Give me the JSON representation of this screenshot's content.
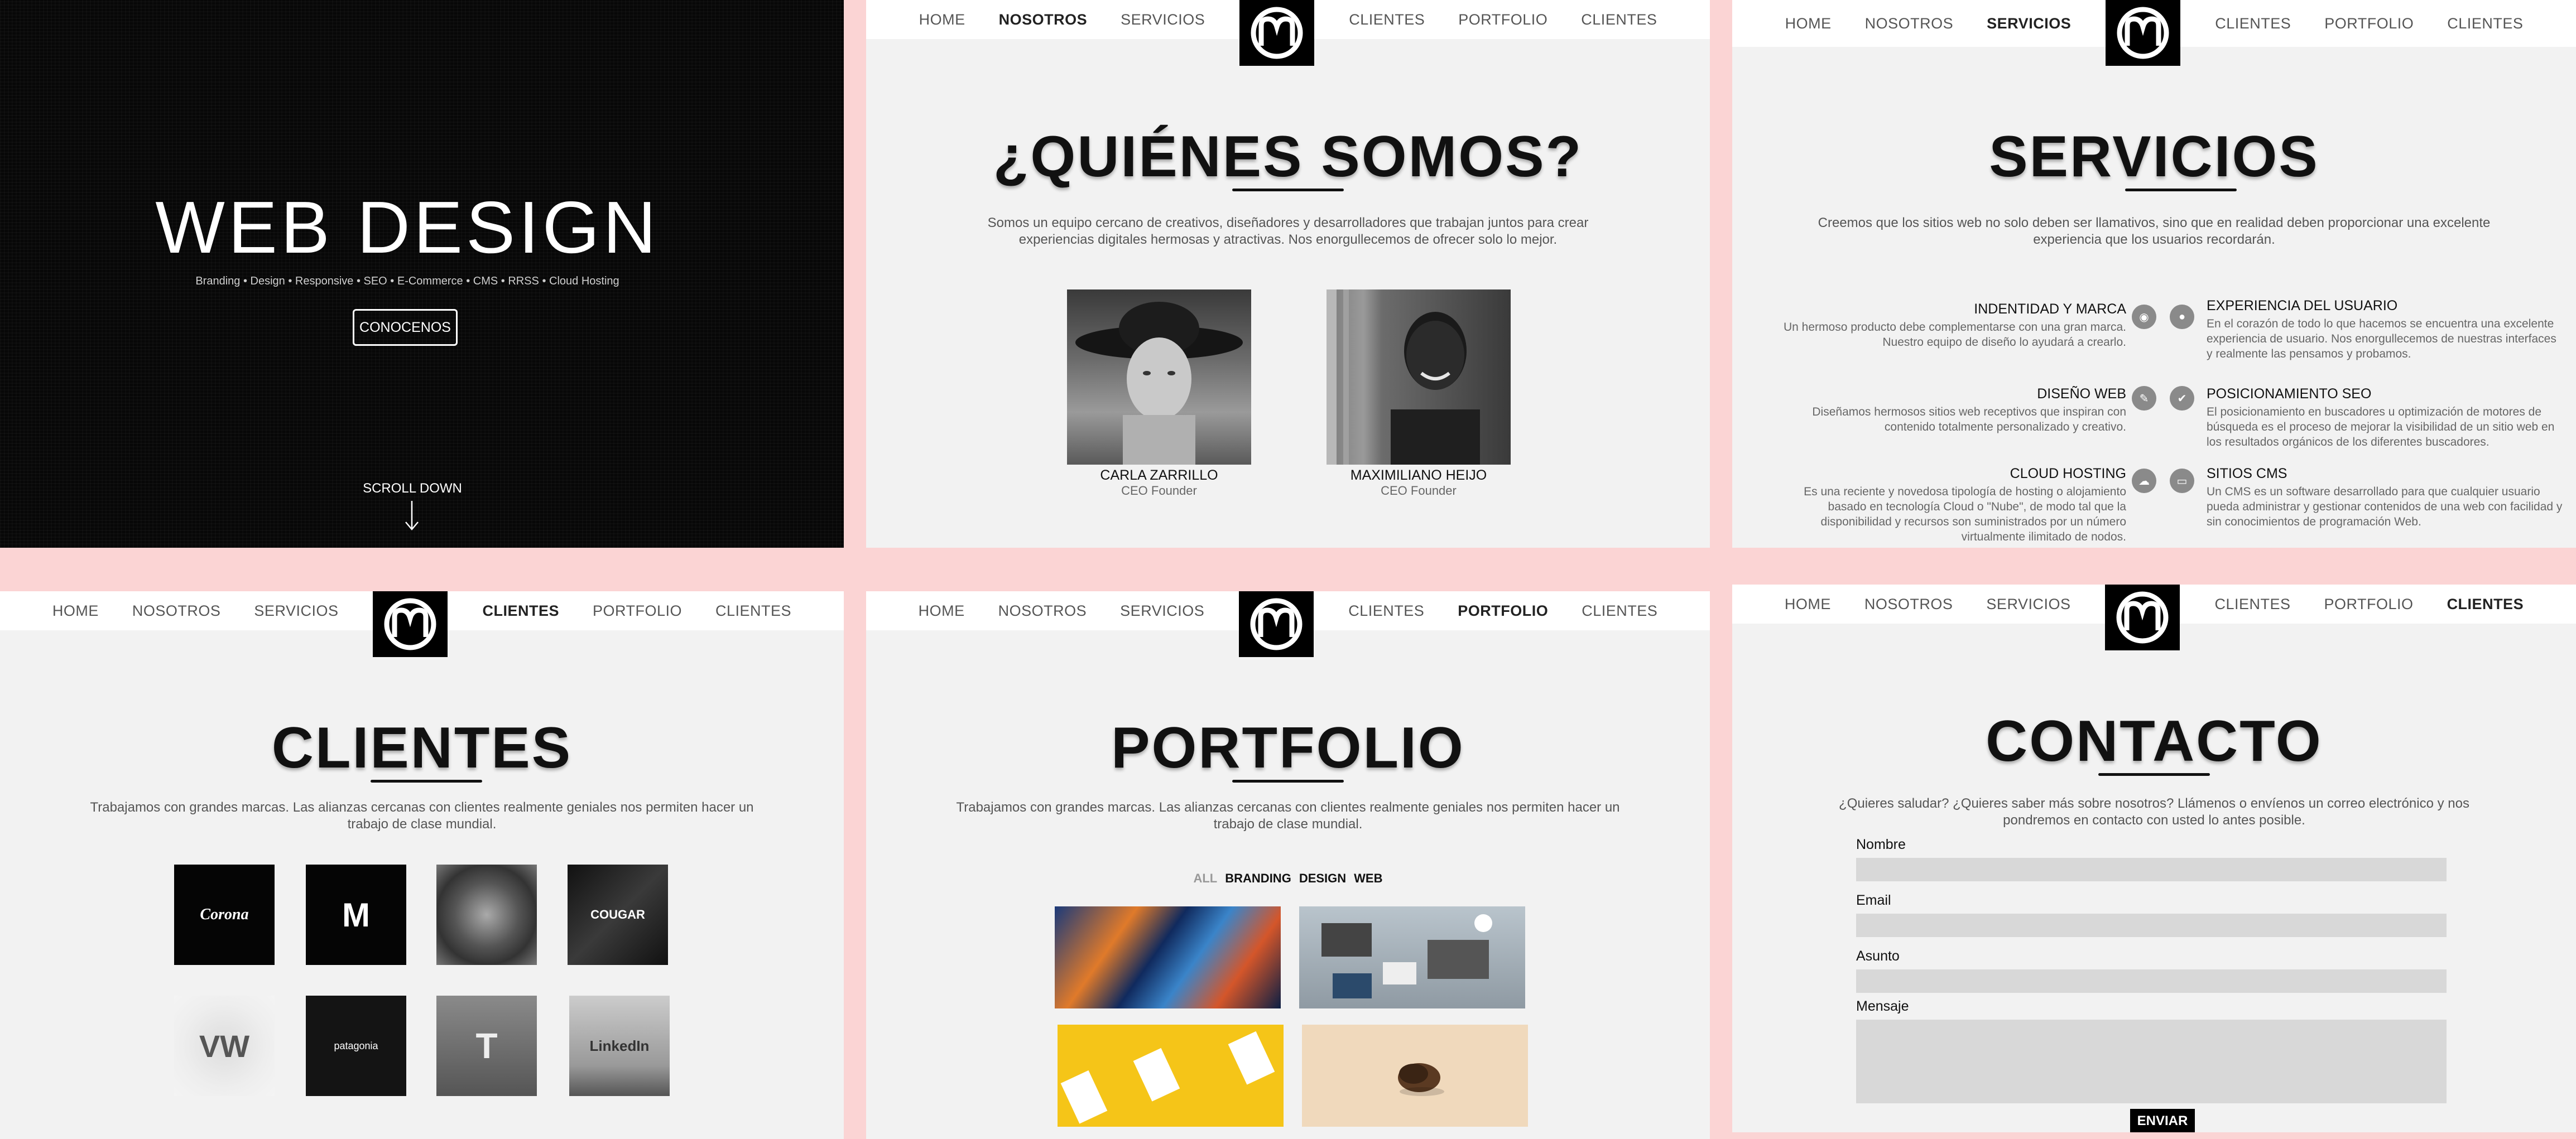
{
  "nav": {
    "left": [
      "HOME",
      "NOSOTROS",
      "SERVICIOS"
    ],
    "right": [
      "CLIENTES",
      "PORTFOLIO",
      "CLIENTES"
    ]
  },
  "hero": {
    "title": "WEB DESIGN",
    "subtitle": "Branding • Design • Responsive • SEO • E-Commerce • CMS • RRSS • Cloud Hosting",
    "button": "CONOCENOS",
    "scroll": "SCROLL DOWN"
  },
  "nosotros": {
    "title": "¿QUIÉNES SOMOS?",
    "text": "Somos un equipo cercano de creativos, diseñadores y desarrolladores que trabajan juntos para crear experiencias digitales hermosas y atractivas. Nos enorgullecemos de ofrecer solo lo mejor.",
    "team": [
      {
        "name": "CARLA ZARRILLO",
        "role": "CEO Founder"
      },
      {
        "name": "MAXIMILIANO HEIJO",
        "role": "CEO Founder"
      }
    ]
  },
  "servicios": {
    "title": "SERVICIOS",
    "text": "Creemos que los sitios web no solo deben ser llamativos, sino que en realidad deben proporcionar una excelente experiencia que los usuarios recordarán.",
    "items": [
      {
        "title": "INDENTIDAD Y MARCA",
        "text": "Un hermoso producto debe complementarse con una gran marca. Nuestro equipo de diseño lo ayudará a crearlo.",
        "icon": "eye-icon",
        "glyph": "◉"
      },
      {
        "title": "EXPERIENCIA DEL USUARIO",
        "text": "En el corazón de todo lo que hacemos se encuentra una excelente experiencia de usuario. Nos enorgullecemos de nuestras interfaces y realmente las pensamos y probamos.",
        "icon": "user-icon",
        "glyph": "●"
      },
      {
        "title": "DISEÑO WEB",
        "text": "Diseñamos hermosos sitios web receptivos que inspiran con contenido totalmente personalizado y creativo.",
        "icon": "wrench-icon",
        "glyph": "✎"
      },
      {
        "title": "POSICIONAMIENTO SEO",
        "text": "El posicionamiento en buscadores u optimización de motores de búsqueda es el proceso de mejorar la visibilidad de un sitio web en los resultados orgánicos de los diferentes buscadores.",
        "icon": "check-icon",
        "glyph": "✔"
      },
      {
        "title": "CLOUD HOSTING",
        "text": "Es una reciente y novedosa tipología de hosting o alojamiento basado en tecnología Cloud o \"Nube\", de modo tal que la disponibilidad y recursos son suministrados por un número virtualmente ilimitado de nodos.",
        "icon": "cloud-icon",
        "glyph": "☁"
      },
      {
        "title": "SITIOS CMS",
        "text": "Un CMS es un software desarrollado para que cualquier usuario pueda administrar y gestionar contenidos de una web con facilidad y sin conocimientos de programación Web.",
        "icon": "monitor-icon",
        "glyph": "▭"
      }
    ]
  },
  "clientes": {
    "title": "CLIENTES",
    "text": "Trabajamos con grandes marcas. Las alianzas cercanas con clientes realmente geniales nos permiten hacer un trabajo de clase mundial.",
    "logos": [
      {
        "label": "Corona"
      },
      {
        "label": "M"
      },
      {
        "label": ""
      },
      {
        "label": "COUGAR"
      },
      {
        "label": "VW"
      },
      {
        "label": "patagonia"
      },
      {
        "label": "T"
      },
      {
        "label": "LinkedIn"
      }
    ]
  },
  "portfolio": {
    "title": "PORTFOLIO",
    "text": "Trabajamos con grandes marcas. Las alianzas cercanas con clientes realmente geniales nos permiten hacer un trabajo de clase mundial.",
    "filters": [
      "ALL",
      "BRANDING",
      "DESIGN",
      "WEB"
    ]
  },
  "contacto": {
    "title": "CONTACTO",
    "text": "¿Quieres saludar? ¿Quieres saber más sobre nosotros? Llámenos o envíenos un correo electrónico y nos pondremos en contacto con usted lo antes posible.",
    "fields": [
      "Nombre",
      "Email",
      "Asunto",
      "Mensaje"
    ],
    "submit": "ENVIAR"
  }
}
